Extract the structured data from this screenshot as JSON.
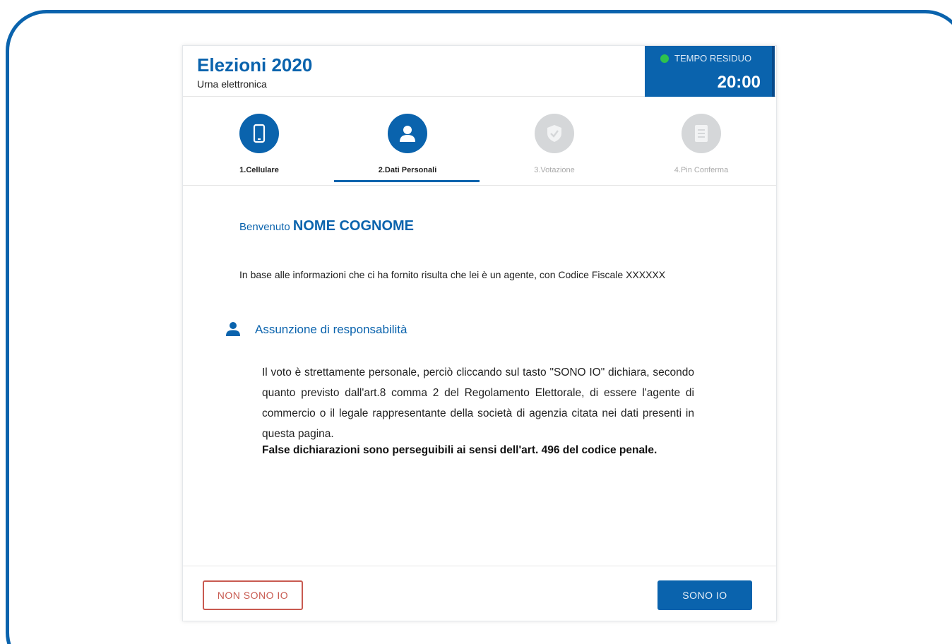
{
  "header": {
    "title": "Elezioni 2020",
    "subtitle": "Urna elettronica"
  },
  "timer": {
    "label": "TEMPO RESIDUO",
    "value": "20:00",
    "status_color": "#2ec24d"
  },
  "steps": [
    {
      "label": "1.Cellulare",
      "icon": "phone-icon",
      "state": "completed"
    },
    {
      "label": "2.Dati Personali",
      "icon": "user-icon",
      "state": "current"
    },
    {
      "label": "3.Votazione",
      "icon": "shield-check-icon",
      "state": "pending"
    },
    {
      "label": "4.Pin Conferma",
      "icon": "document-icon",
      "state": "pending"
    }
  ],
  "welcome": {
    "greeting": "Benvenuto",
    "name": "NOME COGNOME"
  },
  "info_text": "In base alle informazioni che ci ha fornito risulta che lei è un agente, con Codice Fiscale XXXXXX",
  "section": {
    "title": "Assunzione di responsabilità",
    "icon": "user-icon",
    "body": "Il voto è strettamente personale, perciò cliccando sul tasto \"SONO IO\" dichiara, secondo quanto previsto dall'art.8 comma 2 del Regolamento Elettorale, di essere l'agente di commercio o il legale rappresentante della società di agenzia citata nei dati presenti in questa pagina.",
    "warning": "False dichiarazioni sono perseguibili ai sensi dell'art. 496 del codice penale."
  },
  "buttons": {
    "reject": "NON SONO IO",
    "confirm": "SONO IO"
  },
  "colors": {
    "primary": "#0a63ad",
    "reject": "#c85a50",
    "inactive": "#d5d7d9"
  }
}
